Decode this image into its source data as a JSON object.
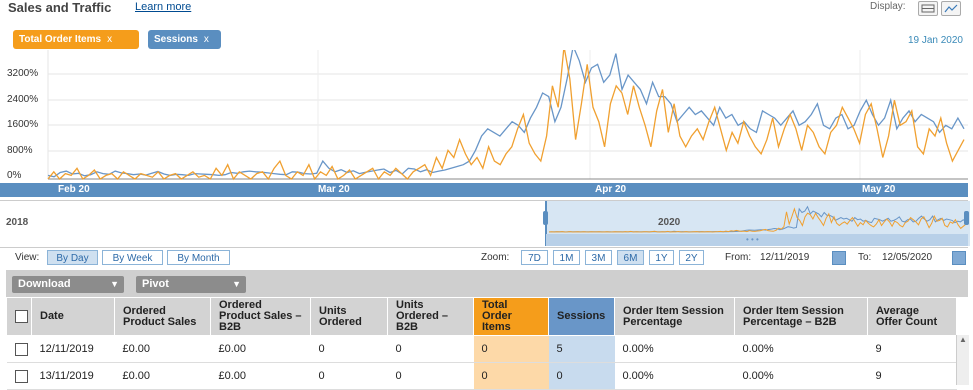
{
  "header": {
    "title": "Sales and Traffic",
    "learn_more": "Learn more",
    "display_label": "Display:"
  },
  "filters": [
    {
      "label": "Total Order Items",
      "close": "x",
      "color": "#f59d1b"
    },
    {
      "label": "Sessions",
      "close": "x",
      "color": "#5a8ec0"
    }
  ],
  "chart_date": "19 Jan 2020",
  "chart_data": {
    "type": "line",
    "x_labels": [
      "Feb 20",
      "Mar 20",
      "Apr 20",
      "May 20"
    ],
    "y_ticks": [
      "3200%",
      "2400%",
      "1600%",
      "800%",
      "0%"
    ],
    "ylim": [
      0,
      3600
    ],
    "series": [
      {
        "name": "Sessions",
        "color": "#6996c8",
        "values": [
          100,
          60,
          180,
          220,
          140,
          160,
          90,
          120,
          200,
          150,
          130,
          220,
          170,
          150,
          120,
          140,
          110,
          160,
          210,
          140,
          100,
          130,
          120,
          100,
          150,
          140,
          130,
          120,
          100,
          120,
          180,
          160,
          200,
          220,
          200,
          190,
          170,
          150,
          130,
          120,
          200,
          190,
          150,
          140,
          160,
          500,
          300,
          200,
          260,
          180,
          230,
          150,
          190,
          220,
          250,
          280,
          180,
          240,
          140,
          300,
          280,
          200,
          260,
          180,
          220,
          250,
          300,
          350,
          400,
          500,
          800,
          1200,
          1400,
          1300,
          1200,
          1400,
          1600,
          1500,
          1300,
          1700,
          2000,
          2400,
          2300,
          1600,
          2000,
          2800,
          3700,
          3300,
          2700,
          3100,
          3200,
          2700,
          2900,
          3500,
          2500,
          2900,
          2700,
          2500,
          2100,
          2700,
          2300,
          2300,
          2100,
          1600,
          1800,
          2000,
          1800,
          1900,
          1700,
          1500,
          2000,
          1700,
          1800,
          1500,
          1600,
          1400,
          1300,
          1900,
          1800,
          1700,
          1500,
          1700,
          1900,
          1500,
          1600,
          1800,
          2100,
          1500,
          1400,
          1700,
          1800,
          1400,
          1500,
          1900,
          2200,
          1800,
          1500,
          1700,
          2200,
          1400,
          1700,
          1900,
          1600,
          1800,
          1700,
          1600,
          1300,
          1500,
          1400,
          1700,
          1400
        ]
      },
      {
        "name": "Total Order Items",
        "color": "#f0a030",
        "values": [
          0,
          200,
          0,
          150,
          100,
          300,
          0,
          100,
          250,
          0,
          100,
          150,
          0,
          200,
          100,
          0,
          150,
          100,
          50,
          200,
          0,
          100,
          150,
          0,
          100,
          200,
          50,
          100,
          0,
          300,
          100,
          400,
          0,
          200,
          100,
          0,
          150,
          200,
          0,
          300,
          500,
          100,
          0,
          200,
          100,
          400,
          0,
          200,
          100,
          350,
          0,
          100,
          250,
          0,
          100,
          200,
          300,
          0,
          200,
          100,
          300,
          150,
          0,
          200,
          300,
          400,
          100,
          600,
          300,
          800,
          600,
          1100,
          700,
          400,
          600,
          300,
          900,
          500,
          400,
          700,
          900,
          1400,
          1800,
          1000,
          700,
          500,
          1200,
          2600,
          2000,
          3700,
          2800,
          1100,
          2100,
          3200,
          2000,
          1600,
          900,
          2100,
          2600,
          2400,
          1800,
          2600,
          2000,
          1500,
          900,
          1900,
          2500,
          1300,
          2100,
          1200,
          900,
          1200,
          1400,
          1100,
          1600,
          2000,
          1400,
          800,
          1300,
          1000,
          1600,
          1200,
          900,
          700,
          1100,
          1700,
          900,
          1400,
          1800,
          1400,
          800,
          1500,
          1300,
          900,
          700,
          1300,
          1500,
          2000,
          1700,
          1400,
          1000,
          1800,
          2100,
          1400,
          600,
          1200,
          2200,
          1500,
          1600,
          1900,
          900,
          700,
          1400,
          1200,
          1700,
          1000,
          500,
          800,
          1100
        ]
      }
    ]
  },
  "navigator": {
    "left_year": "2018",
    "center_year": "2020"
  },
  "view": {
    "label": "View:",
    "options": [
      "By Day",
      "By Week",
      "By Month"
    ],
    "selected": "By Day"
  },
  "zoom": {
    "label": "Zoom:",
    "options": [
      "7D",
      "1M",
      "3M",
      "6M",
      "1Y",
      "2Y"
    ],
    "selected": "6M"
  },
  "range": {
    "from_label": "From:",
    "from": "12/11/2019",
    "to_label": "To:",
    "to": "12/05/2020"
  },
  "toolbar": {
    "download": "Download",
    "pivot": "Pivot"
  },
  "table": {
    "headers": [
      "Date",
      "Ordered Product Sales",
      "Ordered Product Sales – B2B",
      "Units Ordered",
      "Units Ordered – B2B",
      "Total Order Items",
      "Sessions",
      "Order Item Session Percentage",
      "Order Item Session Percentage – B2B",
      "Average Offer Count"
    ],
    "rows": [
      [
        "12/11/2019",
        "£0.00",
        "£0.00",
        "0",
        "0",
        "0",
        "5",
        "0.00%",
        "0.00%",
        "9"
      ],
      [
        "13/11/2019",
        "£0.00",
        "£0.00",
        "0",
        "0",
        "0",
        "0",
        "0.00%",
        "0.00%",
        "9"
      ]
    ]
  }
}
